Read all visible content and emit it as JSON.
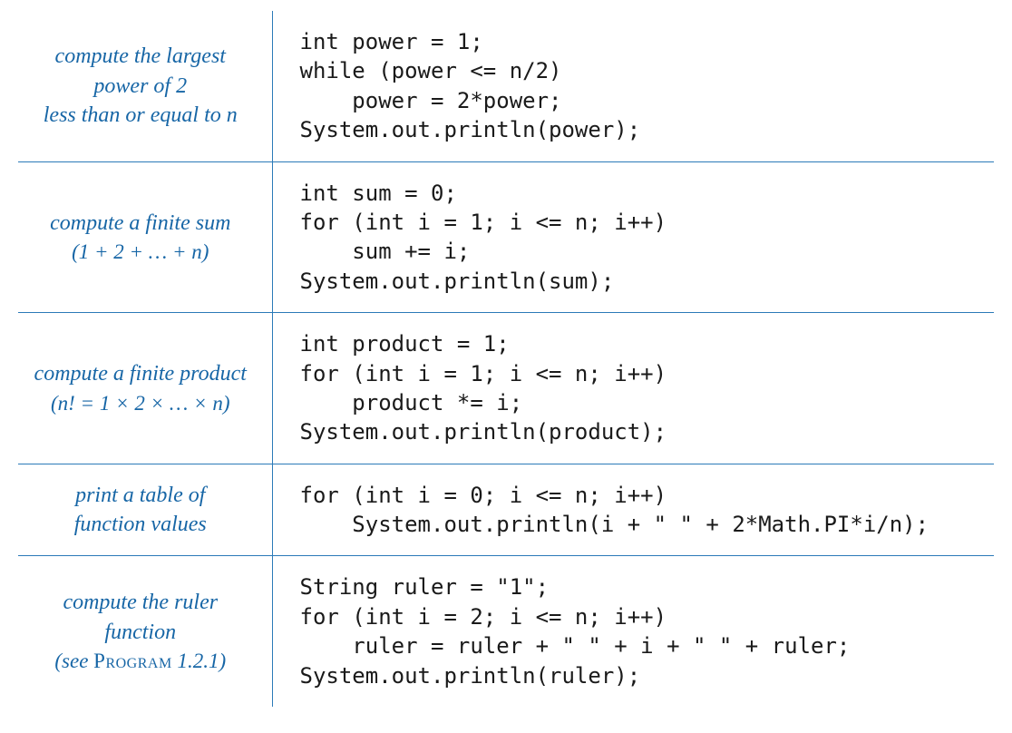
{
  "accent_color": "#1766a6",
  "rows": [
    {
      "desc_line1": "compute the largest",
      "desc_line2": "power of 2",
      "desc_line3": "less than or equal to n",
      "code": "int power = 1;\nwhile (power <= n/2)\n    power = 2*power;\nSystem.out.println(power);"
    },
    {
      "desc_line1": "compute a finite sum",
      "desc_line2": "(1 + 2 + … + n)",
      "code": "int sum = 0;\nfor (int i = 1; i <= n; i++)\n    sum += i;\nSystem.out.println(sum);"
    },
    {
      "desc_line1": "compute a finite product",
      "desc_line2": "(n! = 1 × 2 ×  … × n)",
      "code": "int product = 1;\nfor (int i = 1; i <= n; i++)\n    product *= i;\nSystem.out.println(product);"
    },
    {
      "desc_line1": "print a table of",
      "desc_line2": "function values",
      "code": "for (int i = 0; i <= n; i++)\n    System.out.println(i + \" \" + 2*Math.PI*i/n);"
    },
    {
      "desc_line1": "compute the ruler function",
      "desc_line2_see": "(see ",
      "desc_line2_program": "Program",
      "desc_line2_num": " 1.2.1)",
      "code": "String ruler = \"1\";\nfor (int i = 2; i <= n; i++)\n    ruler = ruler + \" \" + i + \" \" + ruler;\nSystem.out.println(ruler);"
    }
  ]
}
